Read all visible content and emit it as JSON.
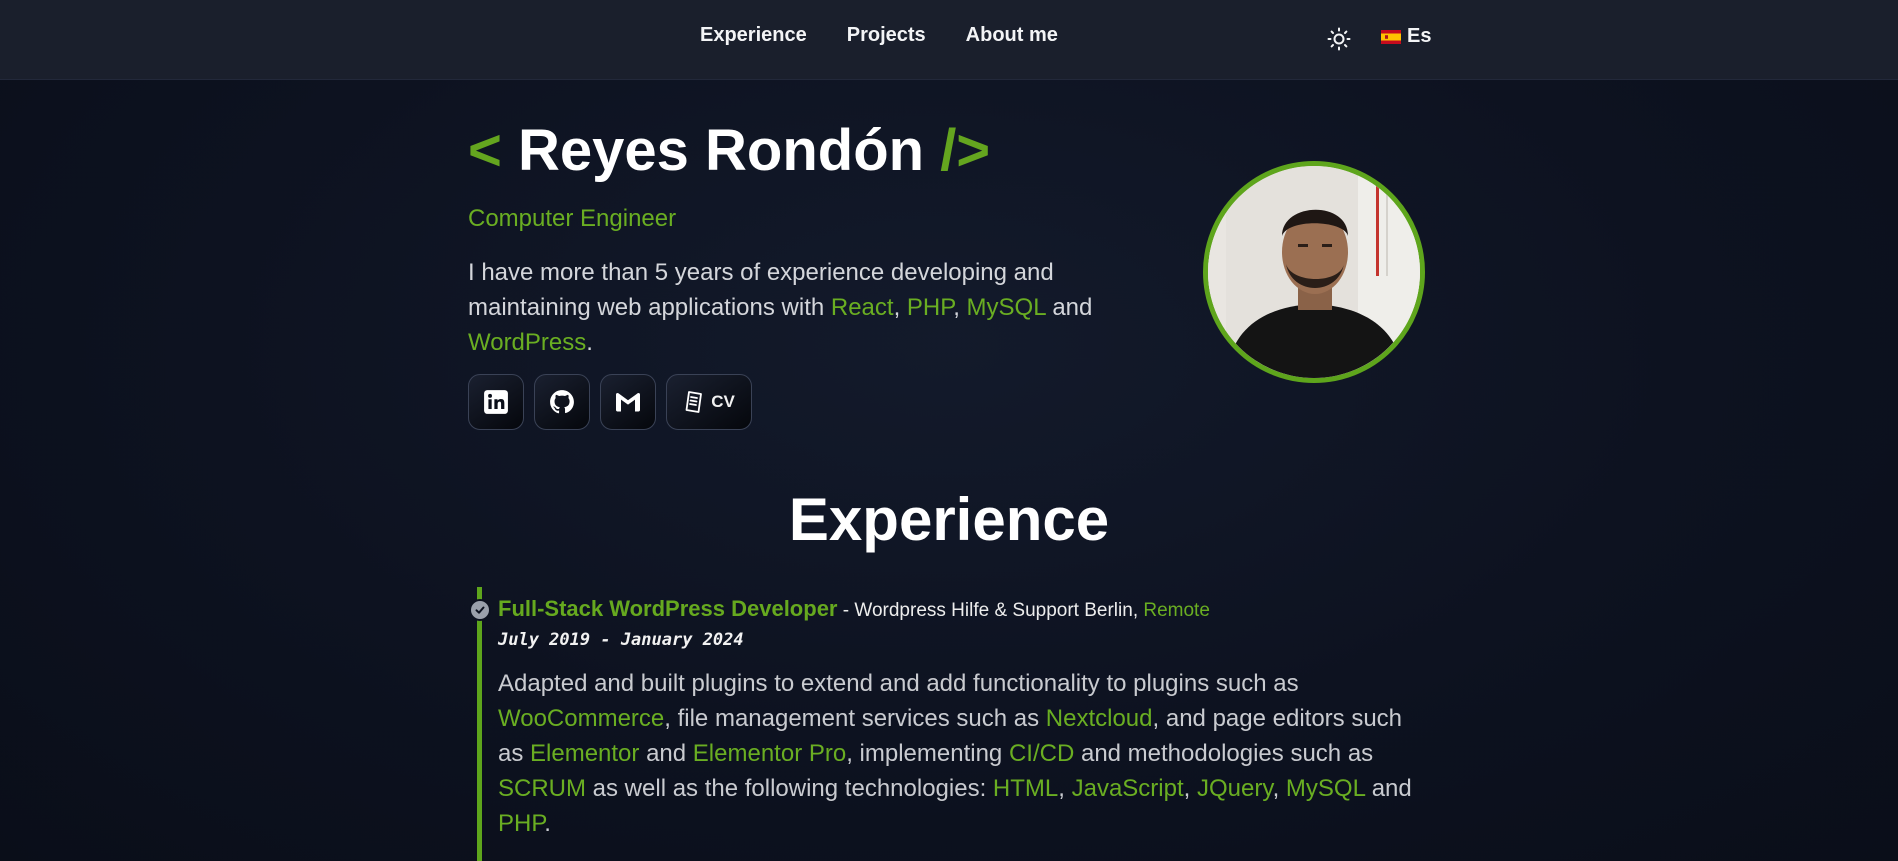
{
  "nav": {
    "links": [
      "Experience",
      "Projects",
      "About me"
    ],
    "language": "Es"
  },
  "hero": {
    "bracket_open": "<",
    "name": "Reyes Rondón",
    "bracket_close": "/>",
    "role": "Computer Engineer",
    "bio": {
      "intro": "I have more than 5 years of experience developing and maintaining web applications with ",
      "tech": [
        "React",
        "PHP",
        "MySQL",
        "WordPress"
      ],
      "sep1": ", ",
      "sep2": ", ",
      "and": " and ",
      "end": "."
    }
  },
  "socials": {
    "icons": [
      "linkedin-icon",
      "github-icon",
      "gmail-icon",
      "document-icon"
    ],
    "cv_label": "CV"
  },
  "experience": {
    "section_title": "Experience",
    "item": {
      "role": "Full-Stack WordPress Developer",
      "company": " - Wordpress Hilfe & Support Berlin, ",
      "location": "Remote",
      "dates": "July 2019 - January 2024",
      "desc": [
        {
          "t": "Adapted and built plugins to extend and add functionality to plugins such as ",
          "h": false
        },
        {
          "t": "WooCommerce",
          "h": true
        },
        {
          "t": ", file management services such as ",
          "h": false
        },
        {
          "t": "Nextcloud",
          "h": true
        },
        {
          "t": ", and page editors such as ",
          "h": false
        },
        {
          "t": "Elementor",
          "h": true
        },
        {
          "t": " and ",
          "h": false
        },
        {
          "t": "Elementor Pro",
          "h": true
        },
        {
          "t": ", implementing ",
          "h": false
        },
        {
          "t": "CI/CD",
          "h": true
        },
        {
          "t": " and methodologies such as  ",
          "h": false
        },
        {
          "t": "SCRUM",
          "h": true
        },
        {
          "t": " as well as the following technologies: ",
          "h": false
        },
        {
          "t": "HTML",
          "h": true
        },
        {
          "t": ", ",
          "h": false
        },
        {
          "t": "JavaScript",
          "h": true
        },
        {
          "t": ", ",
          "h": false
        },
        {
          "t": "JQuery",
          "h": true
        },
        {
          "t": ", ",
          "h": false
        },
        {
          "t": "MySQL",
          "h": true
        },
        {
          "t": " and ",
          "h": false
        },
        {
          "t": "PHP",
          "h": true
        },
        {
          "t": ".",
          "h": false
        }
      ]
    }
  },
  "colors": {
    "accent": "#6aae22",
    "background": "#0d1220",
    "nav_background": "#1a1f2c"
  }
}
